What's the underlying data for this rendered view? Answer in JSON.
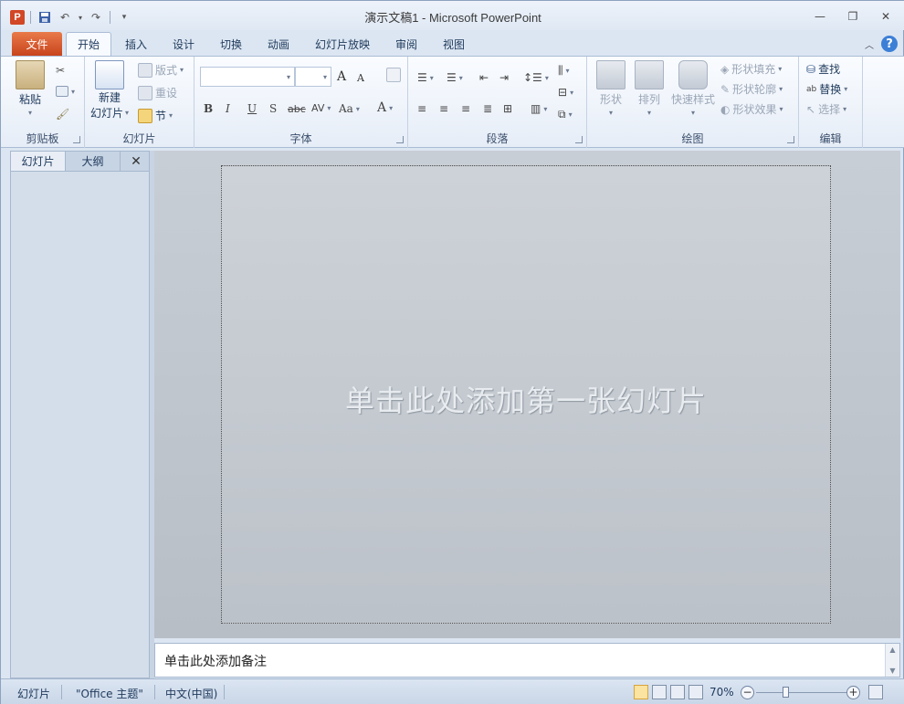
{
  "window": {
    "title": "演示文稿1  -  Microsoft PowerPoint"
  },
  "qat": {
    "app_icon_letter": "P",
    "undo_label": "↶",
    "redo_label": "↷"
  },
  "tabs": [
    {
      "label": "文件"
    },
    {
      "label": "开始"
    },
    {
      "label": "插入"
    },
    {
      "label": "设计"
    },
    {
      "label": "切换"
    },
    {
      "label": "动画"
    },
    {
      "label": "幻灯片放映"
    },
    {
      "label": "审阅"
    },
    {
      "label": "视图"
    }
  ],
  "ribbon": {
    "clipboard": {
      "paste": "粘贴",
      "label": "剪贴板"
    },
    "slides": {
      "new_slide_1": "新建",
      "new_slide_2": "幻灯片",
      "layout": "版式",
      "reset": "重设",
      "section": "节",
      "label": "幻灯片"
    },
    "font": {
      "label": "字体",
      "bold": "B",
      "italic": "I",
      "underline": "U",
      "shadow": "S",
      "strike": "abc",
      "spacing": "AV",
      "case": "Aa",
      "color": "A",
      "grow": "A",
      "shrink": "A"
    },
    "paragraph": {
      "label": "段落"
    },
    "drawing": {
      "shapes": "形状",
      "arrange": "排列",
      "quick_styles": "快速样式",
      "fill": "形状填充",
      "outline": "形状轮廓",
      "effects": "形状效果",
      "label": "绘图"
    },
    "editing": {
      "find": "查找",
      "replace": "替换",
      "select": "选择",
      "label": "编辑"
    }
  },
  "left_pane": {
    "tab_slides": "幻灯片",
    "tab_outline": "大纲",
    "close": "✕"
  },
  "slide": {
    "title_placeholder": "单击此处添加第一张幻灯片"
  },
  "notes": {
    "placeholder": "单击此处添加备注"
  },
  "status": {
    "slide": "幻灯片",
    "theme": "\"Office 主题\"",
    "language": "中文(中国)",
    "zoom": "70%"
  }
}
